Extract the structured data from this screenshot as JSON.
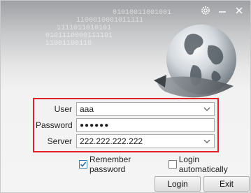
{
  "background_binary": [
    "01010011001001",
    "1100010001011111",
    "1111011010101",
    "0101110000111101",
    "11001100110"
  ],
  "title_buttons": [
    {
      "name": "settings-button",
      "icon": "gear-icon"
    },
    {
      "name": "minimize-button",
      "icon": "minimize-icon"
    },
    {
      "name": "close-button",
      "icon": "close-icon"
    }
  ],
  "form": {
    "user": {
      "label": "User",
      "value": "aaa"
    },
    "password": {
      "label": "Password",
      "value": "●●●●●●"
    },
    "server": {
      "label": "Server",
      "value": "222.222.222.222"
    }
  },
  "options": {
    "remember": {
      "label": "Remember password",
      "checked": true
    },
    "auto": {
      "label": "Login automatically",
      "checked": false
    }
  },
  "buttons": {
    "login": "Login",
    "exit": "Exit"
  },
  "colors": {
    "highlight_border": "#e21e26",
    "check_accent": "#3c7fb1"
  }
}
